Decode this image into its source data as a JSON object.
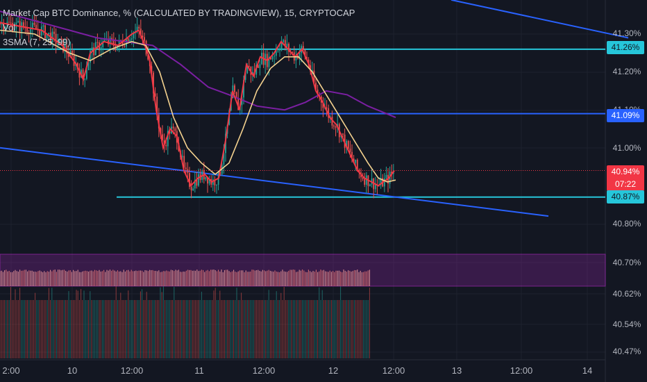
{
  "chart_data": {
    "type": "candlestick",
    "title": "Market Cap BTC Dominance, % (CALCULATED BY TRADINGVIEW), 15, CRYPTOCAP",
    "indicators": [
      "Vol",
      "3SMA (7, 25, 99)"
    ],
    "ylim": [
      40.45,
      41.35
    ],
    "y_ticks": [
      "41.30%",
      "41.20%",
      "41.10%",
      "41.00%",
      "40.80%",
      "40.70%",
      "40.62%",
      "40.54%",
      "40.47%"
    ],
    "x_ticks": [
      "2:00",
      "10",
      "12:00",
      "11",
      "12:00",
      "12",
      "12:00",
      "13",
      "12:00",
      "14"
    ],
    "price": {
      "value": "40.94%",
      "countdown": "07:22",
      "color": "#f23645"
    },
    "horizontal_levels": [
      {
        "value": 41.26,
        "label": "41.26%",
        "color": "#26c6da"
      },
      {
        "value": 41.09,
        "label": "41.09%",
        "color": "#2962ff"
      },
      {
        "value": 40.87,
        "label": "40.87%",
        "color": "#26c6da"
      }
    ],
    "trendlines": [
      {
        "from": {
          "t": 0,
          "v": 41.0
        },
        "to": {
          "t": 0.79,
          "v": 40.82
        },
        "color": "#2962ff"
      },
      {
        "from": {
          "t": 0.65,
          "v": 41.39
        },
        "to": {
          "t": 0.905,
          "v": 41.29
        },
        "color": "#2962ff"
      }
    ],
    "close_path": [
      [
        0.0,
        41.33
      ],
      [
        0.06,
        41.31
      ],
      [
        0.09,
        41.27
      ],
      [
        0.11,
        41.22
      ],
      [
        0.12,
        41.18
      ],
      [
        0.13,
        41.25
      ],
      [
        0.15,
        41.28
      ],
      [
        0.17,
        41.27
      ],
      [
        0.19,
        41.3
      ],
      [
        0.2,
        41.31
      ],
      [
        0.215,
        41.24
      ],
      [
        0.225,
        41.1
      ],
      [
        0.235,
        41.0
      ],
      [
        0.245,
        41.05
      ],
      [
        0.255,
        41.03
      ],
      [
        0.265,
        40.94
      ],
      [
        0.275,
        40.9
      ],
      [
        0.285,
        40.92
      ],
      [
        0.295,
        40.93
      ],
      [
        0.305,
        40.91
      ],
      [
        0.315,
        40.92
      ],
      [
        0.325,
        41.02
      ],
      [
        0.335,
        41.15
      ],
      [
        0.345,
        41.1
      ],
      [
        0.355,
        41.22
      ],
      [
        0.365,
        41.19
      ],
      [
        0.375,
        41.24
      ],
      [
        0.385,
        41.23
      ],
      [
        0.395,
        41.25
      ],
      [
        0.405,
        41.28
      ],
      [
        0.415,
        41.26
      ],
      [
        0.425,
        41.24
      ],
      [
        0.435,
        41.26
      ],
      [
        0.445,
        41.22
      ],
      [
        0.455,
        41.15
      ],
      [
        0.465,
        41.12
      ],
      [
        0.475,
        41.08
      ],
      [
        0.485,
        41.06
      ],
      [
        0.495,
        41.02
      ],
      [
        0.505,
        40.98
      ],
      [
        0.515,
        40.94
      ],
      [
        0.525,
        40.92
      ],
      [
        0.535,
        40.91
      ],
      [
        0.545,
        40.9
      ],
      [
        0.552,
        40.91
      ],
      [
        0.56,
        40.92
      ],
      [
        0.568,
        40.94
      ]
    ],
    "sma_fast": [
      [
        0.0,
        41.31
      ],
      [
        0.05,
        41.3
      ],
      [
        0.1,
        41.25
      ],
      [
        0.13,
        41.23
      ],
      [
        0.16,
        41.26
      ],
      [
        0.19,
        41.28
      ],
      [
        0.21,
        41.27
      ],
      [
        0.23,
        41.2
      ],
      [
        0.25,
        41.08
      ],
      [
        0.27,
        41.0
      ],
      [
        0.29,
        40.96
      ],
      [
        0.31,
        40.93
      ],
      [
        0.33,
        40.96
      ],
      [
        0.35,
        41.05
      ],
      [
        0.37,
        41.15
      ],
      [
        0.39,
        41.21
      ],
      [
        0.41,
        41.24
      ],
      [
        0.43,
        41.24
      ],
      [
        0.45,
        41.2
      ],
      [
        0.47,
        41.14
      ],
      [
        0.49,
        41.08
      ],
      [
        0.51,
        41.02
      ],
      [
        0.53,
        40.96
      ],
      [
        0.545,
        40.92
      ],
      [
        0.558,
        40.91
      ],
      [
        0.57,
        40.915
      ]
    ],
    "sma_slow": [
      [
        0.0,
        41.36
      ],
      [
        0.06,
        41.33
      ],
      [
        0.1,
        41.31
      ],
      [
        0.14,
        41.29
      ],
      [
        0.18,
        41.28
      ],
      [
        0.22,
        41.27
      ],
      [
        0.26,
        41.22
      ],
      [
        0.3,
        41.16
      ],
      [
        0.33,
        41.14
      ],
      [
        0.37,
        41.11
      ],
      [
        0.41,
        41.1
      ],
      [
        0.44,
        41.12
      ],
      [
        0.47,
        41.15
      ],
      [
        0.5,
        41.14
      ],
      [
        0.53,
        41.11
      ],
      [
        0.57,
        41.08
      ]
    ],
    "volume_band": {
      "color": "#9c27b0"
    }
  }
}
